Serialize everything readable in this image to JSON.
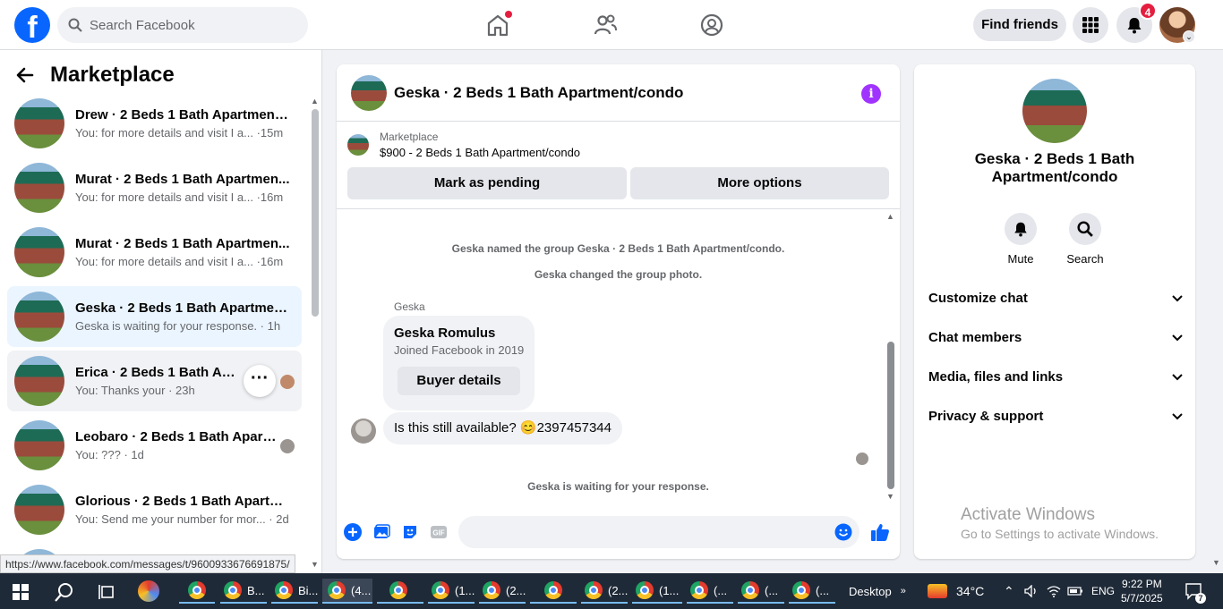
{
  "topbar": {
    "logo_letter": "f",
    "search_placeholder": "Search Facebook",
    "find_friends_label": "Find friends",
    "notification_count": "4",
    "nav_icons": [
      "home-icon",
      "friends-icon",
      "groups-icon"
    ],
    "right_icons": [
      "menu-grid-icon",
      "bell-icon"
    ]
  },
  "sidebar": {
    "title": "Marketplace",
    "conversations": [
      {
        "name": "Drew · 2 Beds 1 Bath Apartment...",
        "message": "You: for more details and visit I a... ·15m"
      },
      {
        "name": "Murat · 2 Beds 1 Bath Apartmen...",
        "message": "You: for more details and visit I a... ·16m"
      },
      {
        "name": "Murat · 2 Beds 1 Bath Apartmen...",
        "message": "You: for more details and visit I a... ·16m"
      },
      {
        "name": "Geska · 2 Beds 1 Bath Apartment...",
        "message": "Geska is waiting for your response. · 1h"
      },
      {
        "name": "Erica · 2 Beds 1 Bath Apartme",
        "message": "You: Thanks your · 23h"
      },
      {
        "name": "Leobaro · 2 Beds 1 Bath Apart...",
        "message": "You: ??? · 1d"
      },
      {
        "name": "Glorious · 2 Beds 1 Bath Apartm...",
        "message": "You: Send me your number for mor... · 2d"
      }
    ],
    "status_url": "https://www.facebook.com/messages/t/9600933676691875/"
  },
  "chat": {
    "title": "Geska · 2 Beds 1 Bath Apartment/condo",
    "marketplace_label": "Marketplace",
    "listing": "$900 - 2 Beds 1 Bath Apartment/condo",
    "mark_pending_label": "Mark as pending",
    "more_options_label": "More options",
    "system_messages": [
      "Geska named the group Geska · 2 Beds 1 Bath Apartment/condo.",
      "Geska changed the group photo."
    ],
    "sender_name": "Geska",
    "card_name": "Geska Romulus",
    "card_joined": "Joined Facebook in 2019",
    "buyer_details_label": "Buyer details",
    "message_text": "Is this still available? 😊2397457344",
    "waiting_text": "Geska is waiting for your response."
  },
  "details": {
    "title_line1": "Geska · 2 Beds 1 Bath",
    "title_line2": "Apartment/condo",
    "mute_label": "Mute",
    "search_label": "Search",
    "sections": [
      "Customize chat",
      "Chat members",
      "Media, files and links",
      "Privacy & support"
    ]
  },
  "watermark": {
    "line1": "Activate Windows",
    "line2": "Go to Settings to activate Windows."
  },
  "taskbar": {
    "items": [
      "B...",
      "Bi...",
      "(4...",
      "(1...",
      "(2...",
      "(2...",
      "(1...",
      "(...",
      "(...",
      "(..."
    ],
    "desktop_label": "Desktop",
    "temperature": "34°C",
    "language": "ENG",
    "time": "9:22 PM",
    "date": "5/7/2025",
    "notif_count": "7",
    "accent": "#0866ff"
  }
}
